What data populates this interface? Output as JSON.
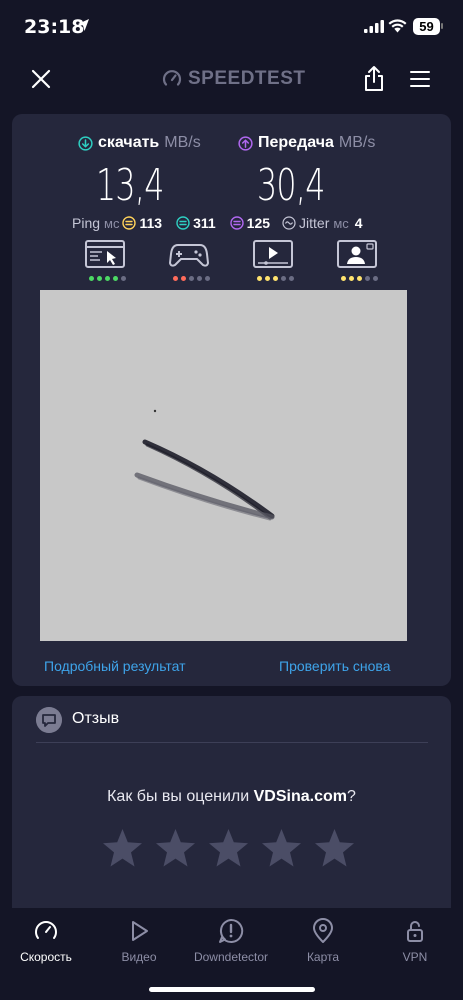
{
  "status": {
    "time": "23:18",
    "battery": "59"
  },
  "header": {
    "logo": "SPEEDTEST"
  },
  "download": {
    "label": "скачать",
    "unit": "MB/s",
    "value": "13,4"
  },
  "upload": {
    "label": "Передача",
    "unit": "MB/s",
    "value": "30,4"
  },
  "ping": {
    "label": "Ping",
    "unit": "мс",
    "idle": "113",
    "download": "311",
    "upload": "125",
    "jitter_label": "Jitter",
    "jitter_unit": "мс",
    "jitter": "4"
  },
  "quality": [
    {
      "icon": "browsing-icon",
      "dots": [
        "#4cd964",
        "#4cd964",
        "#4cd964",
        "#4cd964",
        "#6b6d84"
      ]
    },
    {
      "icon": "gaming-icon",
      "dots": [
        "#ff6b5b",
        "#ff6b5b",
        "#6b6d84",
        "#6b6d84",
        "#6b6d84"
      ]
    },
    {
      "icon": "video-icon",
      "dots": [
        "#ffe36e",
        "#ffe36e",
        "#ffe36e",
        "#6b6d84",
        "#6b6d84"
      ]
    },
    {
      "icon": "video-call-icon",
      "dots": [
        "#ffe36e",
        "#ffe36e",
        "#ffe36e",
        "#6b6d84",
        "#6b6d84"
      ]
    }
  ],
  "links": {
    "detail": "Подробный результат",
    "retry": "Проверить снова"
  },
  "feedback": {
    "title": "Отзыв",
    "question_prefix": "Как бы вы оценили ",
    "provider": "VDSina.com",
    "question_suffix": "?"
  },
  "tabs": [
    {
      "label": "Скорость",
      "icon": "speedometer-icon",
      "active": true
    },
    {
      "label": "Видео",
      "icon": "play-icon"
    },
    {
      "label": "Downdetector",
      "icon": "alert-icon"
    },
    {
      "label": "Карта",
      "icon": "map-pin-icon"
    },
    {
      "label": "VPN",
      "icon": "lock-icon"
    }
  ],
  "colors": {
    "background": "#141526",
    "card": "#25273c",
    "link": "#3ea4ea",
    "download_accent": "#2ecfc2",
    "upload_accent": "#b068f0"
  }
}
